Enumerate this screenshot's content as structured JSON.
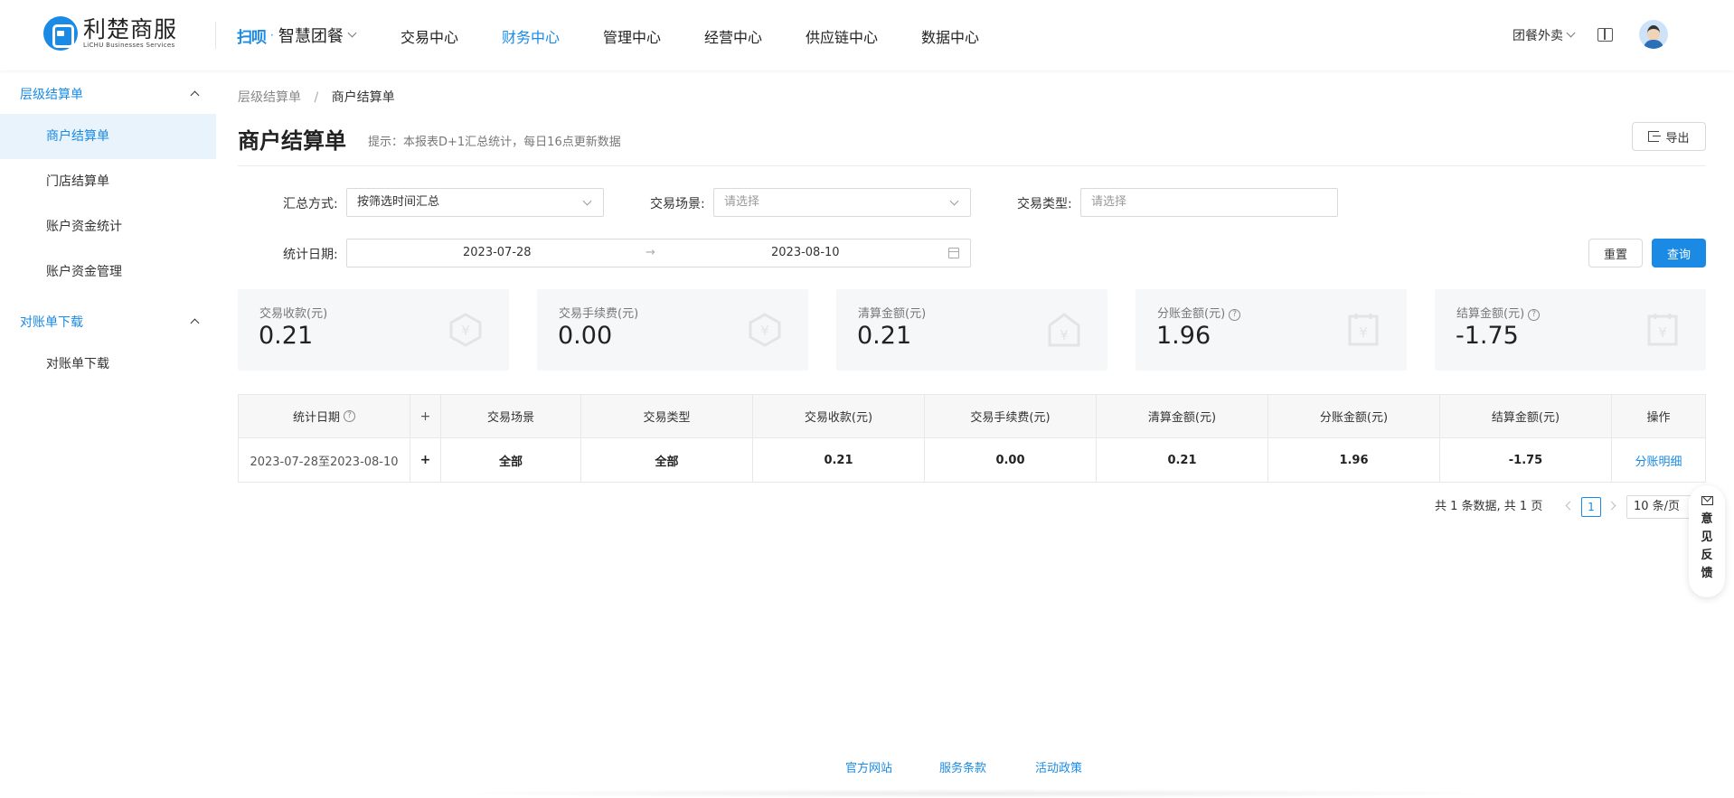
{
  "header": {
    "logo_cn": "利楚商服",
    "logo_en": "LiCHU Businesses Services",
    "brand_mark": "扫呗",
    "brand_dot": "·",
    "brand_name": "智慧团餐",
    "nav": [
      "交易中心",
      "财务中心",
      "管理中心",
      "经营中心",
      "供应链中心",
      "数据中心"
    ],
    "active_nav": "财务中心",
    "right_menu": "团餐外卖",
    "accent_color": "#1a8ae5"
  },
  "sidebar": {
    "groups": [
      {
        "label": "层级结算单",
        "items": [
          "商户结算单",
          "门店结算单",
          "账户资金统计",
          "账户资金管理"
        ]
      },
      {
        "label": "对账单下载",
        "items": [
          "对账单下载"
        ]
      }
    ],
    "active_item": "商户结算单"
  },
  "breadcrumb": {
    "parent": "层级结算单",
    "sep": "/",
    "current": "商户结算单"
  },
  "page": {
    "title": "商户结算单",
    "hint": "提示：本报表D+1汇总统计，每日16点更新数据",
    "export_label": "导出"
  },
  "filters": {
    "summary_label": "汇总方式:",
    "summary_value": "按筛选时间汇总",
    "scene_label": "交易场景:",
    "scene_placeholder": "请选择",
    "type_label": "交易类型:",
    "type_placeholder": "请选择",
    "date_label": "统计日期:",
    "date_start": "2023-07-28",
    "date_arrow": "→",
    "date_end": "2023-08-10",
    "reset_label": "重置",
    "query_label": "查询"
  },
  "cards": [
    {
      "label": "交易收款(元)",
      "value": "0.21",
      "help": false
    },
    {
      "label": "交易手续费(元)",
      "value": "0.00",
      "help": false
    },
    {
      "label": "清算金额(元)",
      "value": "0.21",
      "help": false
    },
    {
      "label": "分账金额(元)",
      "value": "1.96",
      "help": true
    },
    {
      "label": "结算金额(元)",
      "value": "-1.75",
      "help": true
    }
  ],
  "table": {
    "columns": [
      "统计日期",
      "+",
      "交易场景",
      "交易类型",
      "交易收款(元)",
      "交易手续费(元)",
      "清算金额(元)",
      "分账金额(元)",
      "结算金额(元)",
      "操作"
    ],
    "rows": [
      [
        "2023-07-28至2023-08-10",
        "+",
        "全部",
        "全部",
        "0.21",
        "0.00",
        "0.21",
        "1.96",
        "-1.75",
        "分账明细"
      ]
    ]
  },
  "pagination": {
    "summary": "共 1 条数据, 共 1 页",
    "current_page": "1",
    "page_size": "10 条/页"
  },
  "feedback": {
    "label": "意见反馈"
  },
  "footer": {
    "links": [
      "官方网站",
      "服务条款",
      "活动政策"
    ]
  }
}
